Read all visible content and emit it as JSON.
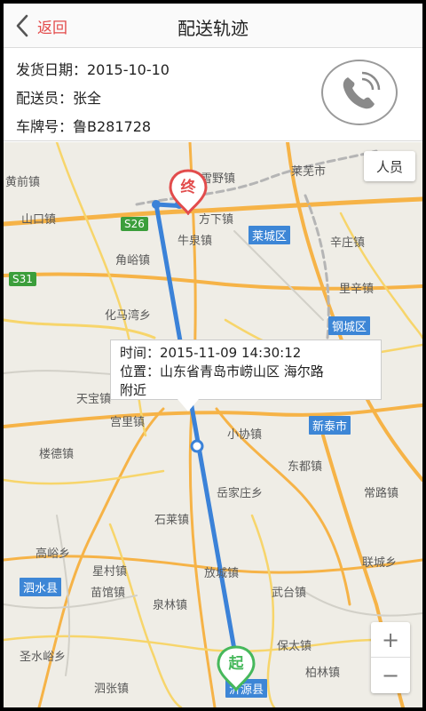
{
  "header": {
    "back_label": "返回",
    "title": "配送轨迹"
  },
  "info": {
    "ship_date": "发货日期：2015-10-10",
    "courier": "配送员：张全",
    "plate": "车牌号：鲁B281728"
  },
  "map": {
    "people_button": "人员",
    "tooltip": {
      "time": "时间：2015-11-09 14:30:12",
      "location_line1": "位置：山东省青岛市崂山区 海尔路",
      "location_line2": "附近"
    },
    "end_marker": "终",
    "start_marker": "起",
    "zoom_in": "+",
    "zoom_out": "−",
    "places": {
      "p01": "黄前镇",
      "p02": "雪野镇",
      "p03": "莱芜市",
      "p04": "山口镇",
      "p05": "方下镇",
      "p06": "牛泉镇",
      "p07": "辛庄镇",
      "p08": "角峪镇",
      "p09": "里辛镇",
      "p10": "化马湾乡",
      "p11": "天宝镇",
      "p12": "宫里镇",
      "p13": "小协镇",
      "p14": "楼德镇",
      "p15": "东都镇",
      "p16": "岳家庄乡",
      "p17": "常路镇",
      "p18": "石莱镇",
      "p19": "高峪乡",
      "p20": "星村镇",
      "p21": "放城镇",
      "p22": "联城乡",
      "p23": "苗馆镇",
      "p24": "武台镇",
      "p25": "泉林镇",
      "p26": "保太镇",
      "p27": "圣水峪乡",
      "p28": "柏林镇",
      "p29": "泗张镇"
    },
    "badges": {
      "b1": "莱城区",
      "b2": "钢城区",
      "b3": "新泰市",
      "b4": "泗水县",
      "b5": "沂源县"
    },
    "highways": {
      "h1": "S26",
      "h2": "S31"
    },
    "colors": {
      "route": "#3b82d8",
      "end_marker": "#e24c4c",
      "start_marker": "#46b85b",
      "back_accent": "#e34b4b"
    }
  }
}
